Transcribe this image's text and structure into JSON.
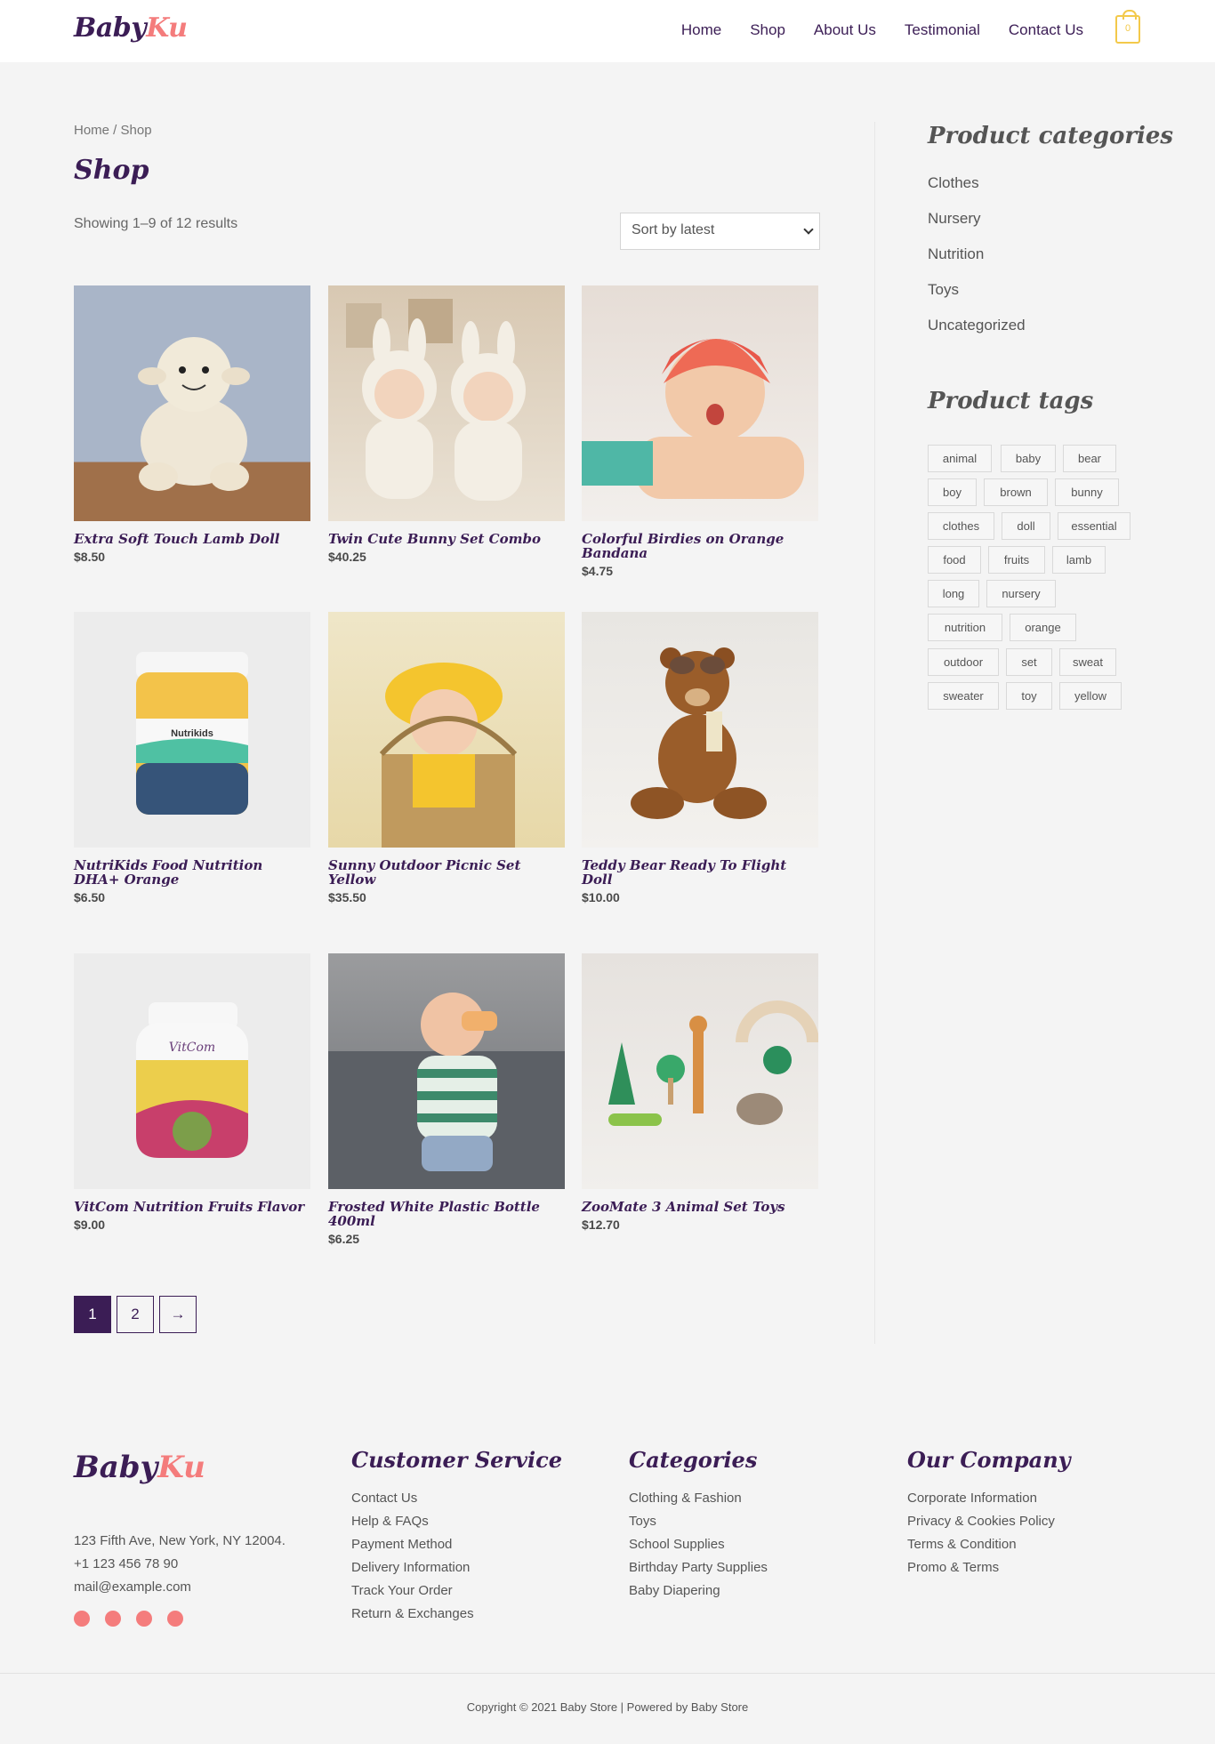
{
  "header": {
    "logo_part1": "Baby",
    "logo_part2": "Ku",
    "nav": [
      "Home",
      "Shop",
      "About Us",
      "Testimonial",
      "Contact Us"
    ],
    "cart_count": "0"
  },
  "main": {
    "breadcrumb": "Home / Shop",
    "title": "Shop",
    "result_count": "Showing 1–9 of 12 results",
    "sort_value": "Sort by latest",
    "products": [
      {
        "title": "Extra Soft Touch Lamb Doll",
        "price": "$8.50"
      },
      {
        "title": "Twin Cute Bunny Set Combo",
        "price": "$40.25"
      },
      {
        "title": "Colorful Birdies on Orange Bandana",
        "price": "$4.75"
      },
      {
        "title": "NutriKids Food Nutrition DHA+ Orange",
        "price": "$6.50",
        "label": "Nutrikids"
      },
      {
        "title": "Sunny Outdoor Picnic Set Yellow",
        "price": "$35.50"
      },
      {
        "title": "Teddy Bear Ready To Flight Doll",
        "price": "$10.00"
      },
      {
        "title": "VitCom Nutrition Fruits Flavor",
        "price": "$9.00",
        "label": "VitCom"
      },
      {
        "title": "Frosted White Plastic Bottle 400ml",
        "price": "$6.25"
      },
      {
        "title": "ZooMate 3 Animal Set Toys",
        "price": "$12.70"
      }
    ],
    "pagination": [
      "1",
      "2",
      "→"
    ]
  },
  "sidebar": {
    "categories_title": "Product categories",
    "categories": [
      "Clothes",
      "Nursery",
      "Nutrition",
      "Toys",
      "Uncategorized"
    ],
    "tags_title": "Product tags",
    "tags": [
      "animal",
      "baby",
      "bear",
      "boy",
      "brown",
      "bunny",
      "clothes",
      "doll",
      "essential",
      "food",
      "fruits",
      "lamb",
      "long",
      "nursery",
      "nutrition",
      "orange",
      "outdoor",
      "set",
      "sweat",
      "sweater",
      "toy",
      "yellow"
    ]
  },
  "footer": {
    "logo_part1": "Baby",
    "logo_part2": "Ku",
    "address": "123 Fifth Ave, New York, NY 12004.",
    "phone": "+1 123 456 78 90",
    "email": "mail@example.com",
    "social_icons": [
      "facebook-icon",
      "twitter-icon",
      "instagram-icon",
      "youtube-icon"
    ],
    "customer_service": {
      "title": "Customer Service",
      "items": [
        "Contact Us",
        "Help & FAQs",
        "Payment Method",
        "Delivery Information",
        "Track Your Order",
        "Return & Exchanges"
      ]
    },
    "categories": {
      "title": "Categories",
      "items": [
        "Clothing & Fashion",
        "Toys",
        "School Supplies",
        "Birthday Party Supplies",
        "Baby Diapering"
      ]
    },
    "company": {
      "title": "Our Company",
      "items": [
        "Corporate Information",
        "Privacy & Cookies Policy",
        "Terms & Condition",
        "Promo & Terms"
      ]
    },
    "copyright": "Copyright © 2021 Baby Store | Powered by Baby Store"
  },
  "colors": {
    "brand": "#3b1d55",
    "accent": "#f47c7c",
    "cart": "#f3c94a"
  }
}
